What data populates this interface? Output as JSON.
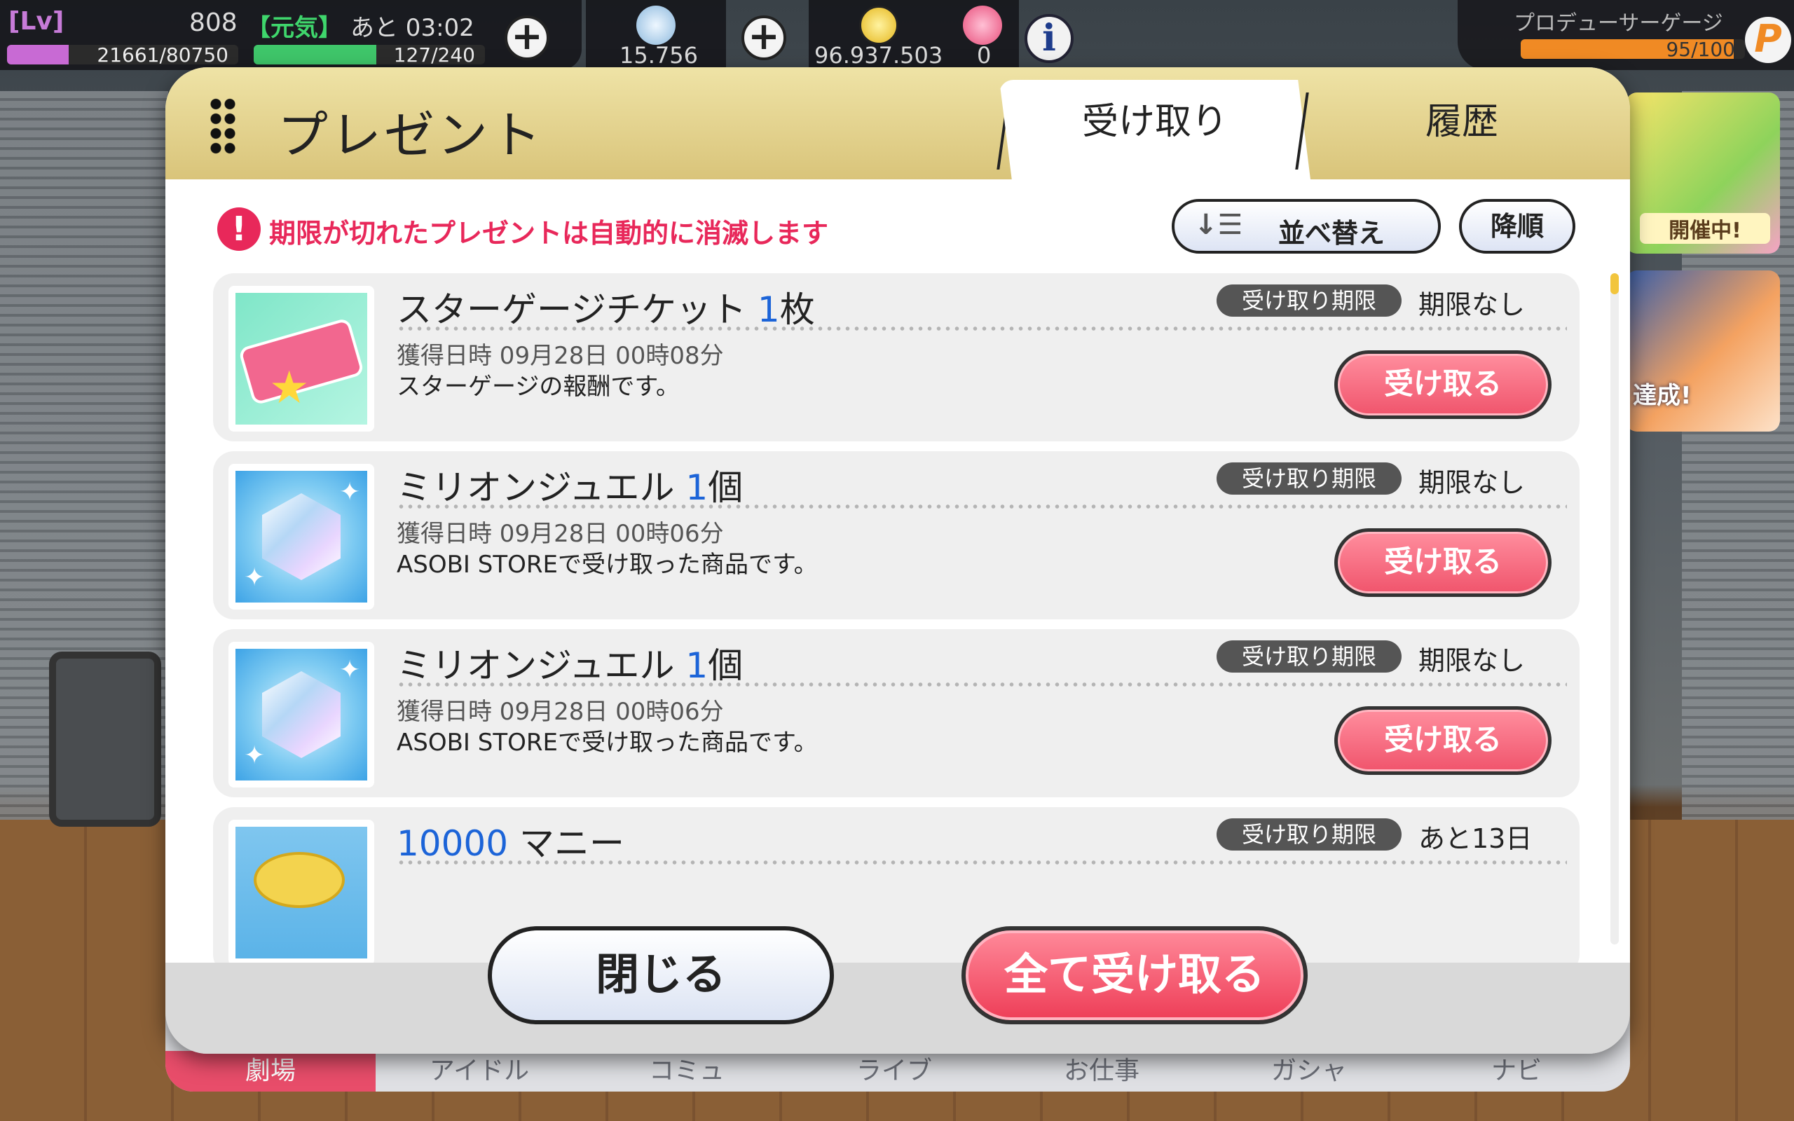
{
  "topbar": {
    "level_label": "[Lv]",
    "level": "808",
    "exp": "21661/80750",
    "exp_fraction": 0.268,
    "stamina_label": "【元気】",
    "stamina_time": "あと 03:02",
    "stamina": "127/240",
    "stamina_fraction": 0.529,
    "jewels": "15.756",
    "money": "96.937.503",
    "tickets": "0",
    "producer_gauge_label": "プロデューサーゲージ",
    "producer_gauge": "95/100",
    "producer_gauge_fraction": 0.95,
    "p_icon": "P",
    "info_icon": "i",
    "plus": "+",
    "colors": {
      "exp": "#c86ad4",
      "stamina": "#3fc66a",
      "producer": "#f08a24"
    }
  },
  "banners": [
    {
      "text": "開催中!"
    },
    {
      "text": "達成!"
    }
  ],
  "modal": {
    "title": "プレゼント",
    "tabs": [
      {
        "label": "受け取り",
        "active": true
      },
      {
        "label": "履歴",
        "active": false
      }
    ],
    "notice_icon": "!",
    "notice": "期限が切れたプレゼントは自動的に消滅します",
    "sort_icon": "↓☰",
    "sort_label": "並べ替え",
    "order_label": "降順",
    "deadline_label": "受け取り期限",
    "receive_label": "受け取る",
    "items": [
      {
        "name": "スターゲージチケット",
        "qty": "1",
        "unit": "枚",
        "deadline": "期限なし",
        "acquired": "獲得日時 09月28日 00時08分",
        "desc": "スターゲージの報酬です。",
        "icon": "ticket-icon"
      },
      {
        "name": "ミリオンジュエル",
        "qty": "1",
        "unit": "個",
        "deadline": "期限なし",
        "acquired": "獲得日時 09月28日 00時06分",
        "desc": "ASOBI STOREで受け取った商品です。",
        "icon": "jewel-icon"
      },
      {
        "name": "ミリオンジュエル",
        "qty": "1",
        "unit": "個",
        "deadline": "期限なし",
        "acquired": "獲得日時 09月28日 00時06分",
        "desc": "ASOBI STOREで受け取った商品です。",
        "icon": "jewel-icon"
      },
      {
        "name": "マニー",
        "qty": "10000",
        "unit": "",
        "deadline": "あと13日",
        "icon": "coin-icon"
      }
    ],
    "close_label": "閉じる",
    "receive_all_label": "全て受け取る"
  },
  "nav": [
    {
      "label": "劇場",
      "active": true
    },
    {
      "label": "アイドル"
    },
    {
      "label": "コミュ"
    },
    {
      "label": "ライブ"
    },
    {
      "label": "お仕事"
    },
    {
      "label": "ガシャ"
    },
    {
      "label": "ナビ"
    }
  ]
}
